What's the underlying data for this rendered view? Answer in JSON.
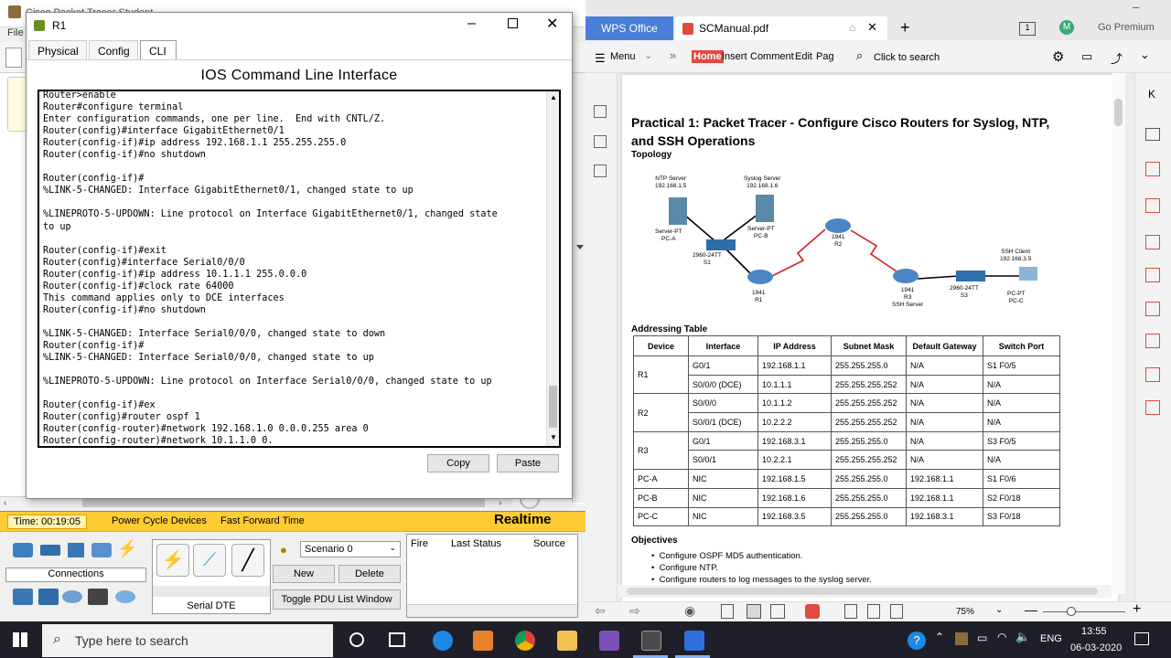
{
  "packet_tracer": {
    "title": "Cisco Packet Tracer Student",
    "file_menu": "File",
    "status": {
      "time": "Time: 00:19:05",
      "power": "Power Cycle Devices",
      "fast_forward": "Fast Forward Time",
      "mode": "Realtime"
    },
    "connections_label": "Connections",
    "link_type": "Serial DTE",
    "scenario": "Scenario 0",
    "new_btn": "New",
    "delete_btn": "Delete",
    "toggle_btn": "Toggle PDU List Window",
    "pdu_cols": [
      "Fire",
      "Last Status",
      "Source"
    ]
  },
  "r1_window": {
    "title": "R1",
    "tabs": [
      "Physical",
      "Config",
      "CLI"
    ],
    "heading": "IOS Command Line Interface",
    "terminal_text": "Router>enable\nRouter#configure terminal\nEnter configuration commands, one per line.  End with CNTL/Z.\nRouter(config)#interface GigabitEthernet0/1\nRouter(config-if)#ip address 192.168.1.1 255.255.255.0\nRouter(config-if)#no shutdown\n\nRouter(config-if)#\n%LINK-5-CHANGED: Interface GigabitEthernet0/1, changed state to up\n\n%LINEPROTO-5-UPDOWN: Line protocol on Interface GigabitEthernet0/1, changed state\nto up\n\nRouter(config-if)#exit\nRouter(config)#interface Serial0/0/0\nRouter(config-if)#ip address 10.1.1.1 255.0.0.0\nRouter(config-if)#clock rate 64000\nThis command applies only to DCE interfaces\nRouter(config-if)#no shutdown\n\n%LINK-5-CHANGED: Interface Serial0/0/0, changed state to down\nRouter(config-if)#\n%LINK-5-CHANGED: Interface Serial0/0/0, changed state to up\n\n%LINEPROTO-5-UPDOWN: Line protocol on Interface Serial0/0/0, changed state to up\n\nRouter(config-if)#ex\nRouter(config)#router ospf 1\nRouter(config-router)#network 192.168.1.0 0.0.0.255 area 0\nRouter(config-router)#network 10.1.1.0 0.",
    "copy_btn": "Copy",
    "paste_btn": "Paste"
  },
  "wps": {
    "tab_office": "WPS Office",
    "tab_doc": "SCManual.pdf",
    "premium": "Go Premium",
    "avatar": "M",
    "page_badge": "1",
    "menu": "Menu",
    "ribbon": [
      "Home",
      "Insert",
      "Comment",
      "Edit",
      "Pag"
    ],
    "search": "Click to search",
    "zoom": "75%"
  },
  "doc": {
    "title": "Practical 1: Packet Tracer - Configure Cisco Routers for Syslog, NTP, and SSH Operations",
    "topology_heading": "Topology",
    "topology_labels": {
      "ntp": "NTP Server\n192.168.1.5",
      "syslog": "Syslog Server\n192.168.1.6",
      "pca": "Server-PT\nPC-A",
      "pcb": "Server-PT\nPC-B",
      "s1": "2960-24TT\nS1",
      "r1": "1941\nR1",
      "r2": "1941\nR2",
      "r3": "1941\nR3\nSSH Server",
      "s3": "2960-24TT\nS3",
      "ssh_client": "SSH Client\n192.168.3.5",
      "pcc": "PC-PT\nPC-C"
    },
    "addressing_heading": "Addressing Table",
    "table_headers": [
      "Device",
      "Interface",
      "IP Address",
      "Subnet Mask",
      "Default Gateway",
      "Switch Port"
    ],
    "table_rows": [
      [
        "R1",
        "G0/1",
        "192.168.1.1",
        "255.255.255.0",
        "N/A",
        "S1 F0/5"
      ],
      [
        "",
        "S0/0/0 (DCE)",
        "10.1.1.1",
        "255.255.255.252",
        "N/A",
        "N/A"
      ],
      [
        "R2",
        "S0/0/0",
        "10.1.1.2",
        "255.255.255.252",
        "N/A",
        "N/A"
      ],
      [
        "",
        "S0/0/1 (DCE)",
        "10.2.2.2",
        "255.255.255.252",
        "N/A",
        "N/A"
      ],
      [
        "R3",
        "G0/1",
        "192.168.3.1",
        "255.255.255.0",
        "N/A",
        "S3 F0/5"
      ],
      [
        "",
        "S0/0/1",
        "10.2.2.1",
        "255.255.255.252",
        "N/A",
        "N/A"
      ],
      [
        "PC-A",
        "NIC",
        "192.168.1.5",
        "255.255.255.0",
        "192.168.1.1",
        "S1 F0/6"
      ],
      [
        "PC-B",
        "NIC",
        "192.168.1.6",
        "255.255.255.0",
        "192.168.1.1",
        "S2 F0/18"
      ],
      [
        "PC-C",
        "NIC",
        "192.168.3.5",
        "255.255.255.0",
        "192.168.3.1",
        "S3 F0/18"
      ]
    ],
    "objectives_heading": "Objectives",
    "objectives": [
      "Configure OSPF MD5 authentication.",
      "Configure NTP.",
      "Configure routers to log messages to the syslog server."
    ]
  },
  "taskbar": {
    "search_placeholder": "Type here to search",
    "lang": "ENG",
    "time": "13:55",
    "date": "06-03-2020"
  }
}
